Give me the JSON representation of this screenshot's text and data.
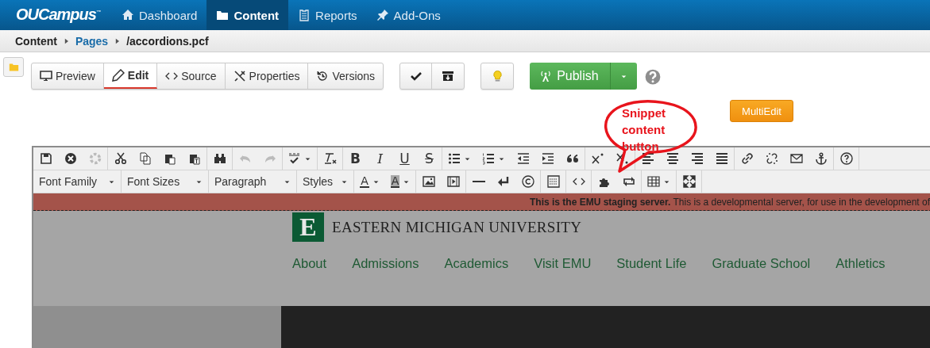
{
  "app": {
    "logo": "OUCampus$^{™}$"
  },
  "nav": [
    {
      "label": "Dashboard",
      "selected": false
    },
    {
      "label": "Content",
      "selected": true
    },
    {
      "label": "Reports",
      "selected": false
    },
    {
      "label": "Add-Ons",
      "selected": false
    }
  ],
  "breadcrumb": [
    {
      "label": "Content",
      "link": false
    },
    {
      "label": "Pages",
      "link": true
    },
    {
      "label": "/accordions.pcf",
      "link": false
    }
  ],
  "view_tabs": [
    {
      "label": "Preview",
      "selected": false
    },
    {
      "label": "Edit",
      "selected": true
    },
    {
      "label": "Source",
      "selected": false
    },
    {
      "label": "Properties",
      "selected": false
    },
    {
      "label": "Versions",
      "selected": false
    }
  ],
  "publish": {
    "label": "Publish"
  },
  "multiedit": {
    "label": "MultiEdit"
  },
  "annotation": {
    "text": "Snippet content button"
  },
  "editor": {
    "toolbar_rows": [
      [
        [
          {
            "kind": "save",
            "disabled": false
          },
          {
            "kind": "cancel",
            "disabled": false
          },
          {
            "kind": "lifebuoy",
            "disabled": true
          }
        ],
        [
          {
            "kind": "cut",
            "disabled": false
          },
          {
            "kind": "copy",
            "disabled": false
          },
          {
            "kind": "paste",
            "disabled": false
          },
          {
            "kind": "paste-text",
            "disabled": false
          }
        ],
        [
          {
            "kind": "find",
            "disabled": false
          }
        ],
        [
          {
            "kind": "undo",
            "disabled": true
          },
          {
            "kind": "redo",
            "disabled": true
          }
        ],
        [
          {
            "kind": "spellcheck",
            "disabled": false
          }
        ],
        [
          {
            "kind": "clear-format",
            "disabled": false
          }
        ],
        [
          {
            "kind": "bold",
            "glyph": "B",
            "disabled": false
          },
          {
            "kind": "italic",
            "glyph": "I",
            "disabled": false
          },
          {
            "kind": "underline",
            "glyph": "U",
            "disabled": false
          },
          {
            "kind": "strike",
            "glyph": "S",
            "disabled": false
          }
        ],
        [
          {
            "kind": "bullets",
            "disabled": false
          },
          {
            "kind": "numbers",
            "disabled": false
          },
          {
            "kind": "outdent",
            "disabled": false
          },
          {
            "kind": "indent",
            "disabled": false
          },
          {
            "kind": "quote",
            "disabled": false
          }
        ],
        [
          {
            "kind": "superscript",
            "disabled": false
          },
          {
            "kind": "subscript",
            "disabled": false
          }
        ],
        [
          {
            "kind": "align-left",
            "disabled": false
          },
          {
            "kind": "align-center",
            "disabled": false
          },
          {
            "kind": "align-right",
            "disabled": false
          },
          {
            "kind": "justify",
            "disabled": false
          }
        ],
        [
          {
            "kind": "link",
            "disabled": false
          },
          {
            "kind": "unlink",
            "disabled": false
          },
          {
            "kind": "mail",
            "disabled": false
          },
          {
            "kind": "anchor",
            "disabled": false
          }
        ],
        [
          {
            "kind": "help",
            "disabled": false
          }
        ]
      ],
      [
        [
          {
            "kind": "menu",
            "label": "Font Family",
            "disabled": false
          }
        ],
        [
          {
            "kind": "menu",
            "label": "Font Sizes",
            "disabled": false
          }
        ],
        [
          {
            "kind": "menu",
            "label": "Paragraph",
            "disabled": false
          }
        ],
        [
          {
            "kind": "menu",
            "label": "Styles",
            "disabled": false
          }
        ],
        [
          {
            "kind": "text-color",
            "glyph": "A",
            "disabled": false
          },
          {
            "kind": "highlight-color",
            "glyph": "A",
            "disabled": false
          }
        ],
        [
          {
            "kind": "image",
            "disabled": false
          },
          {
            "kind": "media",
            "disabled": false
          }
        ],
        [
          {
            "kind": "rule",
            "disabled": false
          },
          {
            "kind": "return",
            "disabled": false
          },
          {
            "kind": "copyright",
            "disabled": false
          }
        ],
        [
          {
            "kind": "nonbreaking",
            "disabled": false
          }
        ],
        [
          {
            "kind": "code",
            "disabled": false
          }
        ],
        [
          {
            "kind": "snippet",
            "disabled": false
          },
          {
            "kind": "swap",
            "disabled": false
          }
        ],
        [
          {
            "kind": "table",
            "disabled": false
          }
        ],
        [
          {
            "kind": "fullscreen",
            "disabled": false
          }
        ]
      ]
    ],
    "banner": "**This is the EMU staging server.** This is a developmental server, for use in the development of",
    "site": {
      "logo_letter": "E",
      "name": "EASTERN MICHIGAN UNIVERSITY",
      "nav": [
        "About",
        "Admissions",
        "Academics",
        "Visit EMU",
        "Student Life",
        "Graduate School",
        "Athletics"
      ]
    }
  }
}
